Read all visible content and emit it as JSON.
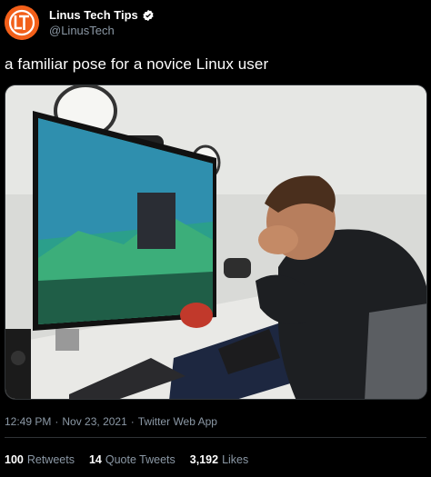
{
  "author": {
    "display_name": "Linus Tech Tips",
    "handle": "@LinusTech",
    "verified": true,
    "avatar_icon": "ltt-logo-icon"
  },
  "tweet": {
    "text": "a familiar pose for a novice Linux user"
  },
  "media": {
    "kind": "photo",
    "icon": "photo-icon"
  },
  "meta": {
    "time": "12:49 PM",
    "sep1": "·",
    "date": "Nov 23, 2021",
    "sep2": "·",
    "source": "Twitter Web App"
  },
  "stats": [
    {
      "count": "100",
      "label": "Retweets"
    },
    {
      "count": "14",
      "label": "Quote Tweets"
    },
    {
      "count": "3,192",
      "label": "Likes"
    }
  ],
  "colors": {
    "background": "#000000",
    "text_primary": "#ffffff",
    "text_secondary": "#8b98a5",
    "brand_orange": "#f25f19",
    "verified_blue": "#1d9bf0"
  }
}
